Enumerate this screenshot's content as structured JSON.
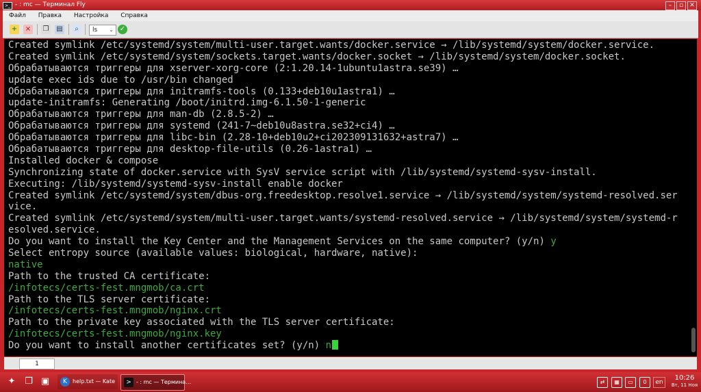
{
  "window": {
    "title": "- : mc — Терминал Fly",
    "app_icon_label": ">_"
  },
  "menu": [
    "Файл",
    "Правка",
    "Настройка",
    "Справка"
  ],
  "toolbar": {
    "encoding_value": "ls",
    "icons": [
      "new-session-icon",
      "close-session-icon",
      "copy-icon",
      "paste-icon",
      "search-icon",
      "apply-icon"
    ]
  },
  "terminal": {
    "lines": [
      {
        "text": "Created symlink /etc/systemd/system/multi-user.target.wants/docker.service → /lib/systemd/system/docker.service."
      },
      {
        "text": "Created symlink /etc/systemd/system/sockets.target.wants/docker.socket → /lib/systemd/system/docker.socket."
      },
      {
        "text": "Обрабатываются триггеры для xserver-xorg-core (2:1.20.14-1ubuntu1astra.se39) …"
      },
      {
        "text": "update exec ids due to /usr/bin changed"
      },
      {
        "text": "Обрабатываются триггеры для initramfs-tools (0.133+deb10u1astra1) …"
      },
      {
        "text": "update-initramfs: Generating /boot/initrd.img-6.1.50-1-generic"
      },
      {
        "text": "Обрабатываются триггеры для man-db (2.8.5-2) …"
      },
      {
        "text": "Обрабатываются триггеры для systemd (241-7~deb10u8astra.se32+ci4) …"
      },
      {
        "text": "Обрабатываются триггеры для libc-bin (2.28-10+deb10u2+ci202309131632+astra7) …"
      },
      {
        "text": "Обрабатываются триггеры для desktop-file-utils (0.26-1astra1) …"
      },
      {
        "text": "Installed docker & compose"
      },
      {
        "text": "Synchronizing state of docker.service with SysV service script with /lib/systemd/systemd-sysv-install."
      },
      {
        "text": "Executing: /lib/systemd/systemd-sysv-install enable docker"
      },
      {
        "text": "Created symlink /etc/systemd/system/dbus-org.freedesktop.resolve1.service → /lib/systemd/system/systemd-resolved.ser"
      },
      {
        "text": "vice."
      },
      {
        "text": "Created symlink /etc/systemd/system/multi-user.target.wants/systemd-resolved.service → /lib/systemd/system/systemd-r"
      },
      {
        "text": "esolved.service."
      },
      {
        "text": "Do you want to install the Key Center and the Management Services on the same computer? (y/n) ",
        "answer": "y"
      },
      {
        "text": "Select entropy source (available values: biological, hardware, native):"
      },
      {
        "text": "",
        "answer": "native"
      },
      {
        "text": "Path to the trusted CA certificate:"
      },
      {
        "text": "",
        "answer": "/infotecs/certs-fest.mngmob/ca.crt"
      },
      {
        "text": "Path to the TLS server certificate:"
      },
      {
        "text": "",
        "answer": "/infotecs/certs-fest.mngmob/nginx.crt"
      },
      {
        "text": "Path to the private key associated with the TLS server certificate:"
      },
      {
        "text": "",
        "answer": "/infotecs/certs-fest.mngmob/nginx.key"
      },
      {
        "text": "Do you want to install another certificates set? (y/n) ",
        "answer": "n",
        "cursor": true
      }
    ]
  },
  "tabs": [
    {
      "label": "1"
    }
  ],
  "taskbar": {
    "tasks": [
      {
        "label": "help.txt — Kate",
        "icon": "kate-icon"
      },
      {
        "label": "- : mc — Термина…",
        "icon": "terminal-icon"
      }
    ],
    "language": "en",
    "clock": {
      "time": "10:26",
      "date": "Вт, 11 Ноя"
    }
  },
  "colors": {
    "frame": "#c8262a",
    "terminal_bg": "#000000",
    "terminal_fg": "#c8c8c8",
    "input_fg": "#3fa93f",
    "cursor": "#37d33a"
  }
}
